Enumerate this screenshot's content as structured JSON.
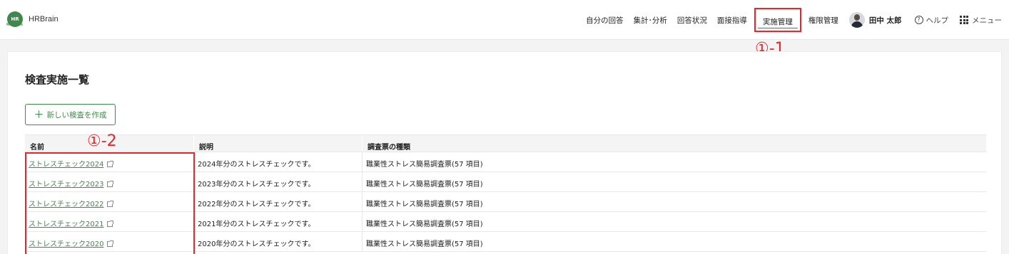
{
  "app": {
    "logo_text": "HR",
    "logo_sub": "HRBrain",
    "brand": "HRBrain"
  },
  "nav": {
    "items": [
      "自分の回答",
      "集計･分析",
      "回答状況",
      "面接指導",
      "実施管理",
      "権限管理"
    ],
    "active": "実施管理",
    "user_name": "田中 太郎",
    "help_label": "ヘルプ",
    "menu_label": "メニュー"
  },
  "annotations": {
    "nav_marker": "①-1",
    "column_marker": "①-2"
  },
  "page": {
    "title": "検査実施一覧",
    "new_button": "新しい検査を作成"
  },
  "table": {
    "headers": [
      "名前",
      "説明",
      "調査票の種類"
    ],
    "rows": [
      {
        "name": "ストレスチェック2024",
        "description": "2024年分のストレスチェックです。",
        "type": "職業性ストレス簡易調査票(57 項目)"
      },
      {
        "name": "ストレスチェック2023",
        "description": "2023年分のストレスチェックです。",
        "type": "職業性ストレス簡易調査票(57 項目)"
      },
      {
        "name": "ストレスチェック2022",
        "description": "2022年分のストレスチェックです。",
        "type": "職業性ストレス簡易調査票(57 項目)"
      },
      {
        "name": "ストレスチェック2021",
        "description": "2021年分のストレスチェックです。",
        "type": "職業性ストレス簡易調査票(57 項目)"
      },
      {
        "name": "ストレスチェック2020",
        "description": "2020年分のストレスチェックです。",
        "type": "職業性ストレス簡易調査票(57 項目)"
      }
    ]
  },
  "colors": {
    "accent": "#3f8a4a",
    "annotation": "#e8262e"
  }
}
